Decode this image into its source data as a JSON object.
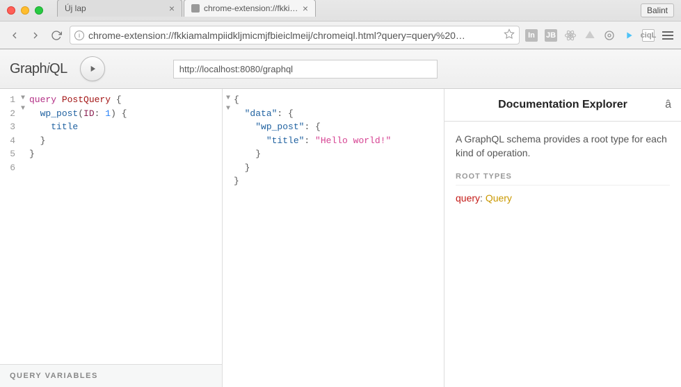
{
  "browser": {
    "profile": "Balint",
    "tabs": [
      {
        "title": "Új lap",
        "active": false
      },
      {
        "title": "chrome-extension://fkkiam",
        "active": true
      }
    ],
    "url": "chrome-extension://fkkiamalmpiidkljmicmjfbieiclmeij/chromeiql.html?query=query%20…",
    "extension_labels": {
      "in": "In",
      "jb": "JB",
      "ciql": "ciqL"
    }
  },
  "graphiql": {
    "logo_prefix": "Graph",
    "logo_italic": "i",
    "logo_suffix": "QL",
    "endpoint": "http://localhost:8080/graphql",
    "query_variables_label": "Query Variables"
  },
  "query_editor": {
    "line_numbers": [
      "1",
      "2",
      "3",
      "4",
      "5",
      "6"
    ],
    "tokens": {
      "kw_query": "query",
      "name": "PostQuery",
      "brace_open": "{",
      "field_wp_post": "wp_post",
      "paren_open": "(",
      "arg_id": "ID",
      "colon": ":",
      "arg_val": "1",
      "paren_close": ")",
      "field_title": "title",
      "brace_close": "}"
    }
  },
  "result": {
    "brace_open": "{",
    "k_data": "\"data\"",
    "k_wp_post": "\"wp_post\"",
    "k_title": "\"title\"",
    "v_title": "\"Hello world!\"",
    "colon": ":",
    "brace_close": "}"
  },
  "docs": {
    "title": "Documentation Explorer",
    "search_glyph": "â",
    "description": "A GraphQL schema provides a root type for each kind of operation.",
    "root_types_label": "root types",
    "root_field": "query",
    "root_type": "Query",
    "colon": ": "
  }
}
